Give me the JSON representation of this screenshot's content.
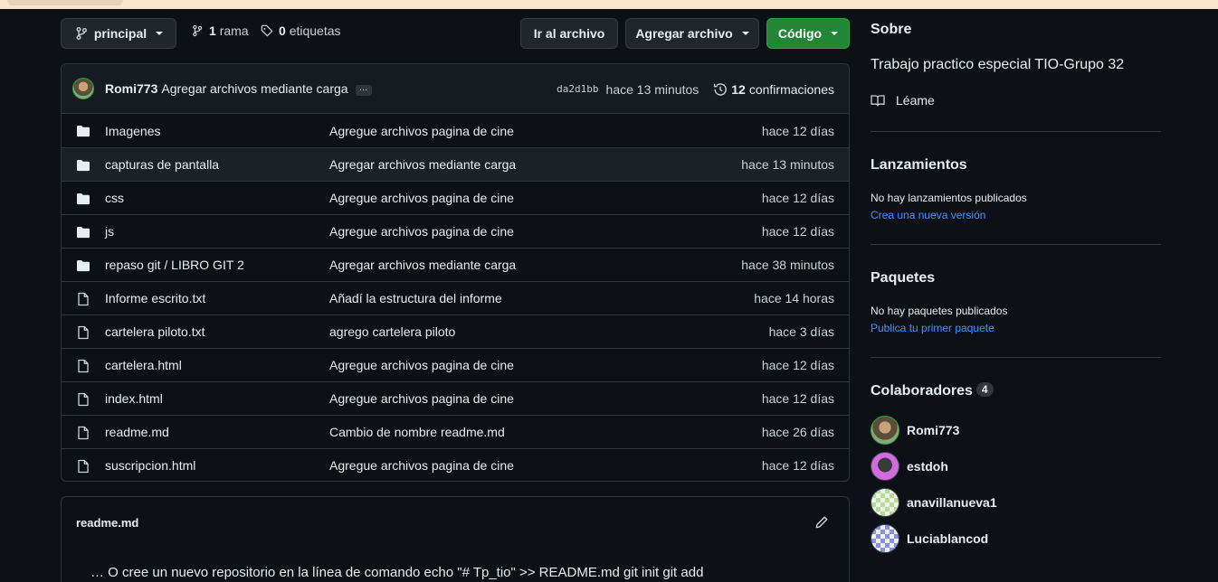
{
  "toolbar": {
    "branch_label": "principal",
    "branches_count": "1",
    "branches_word": "rama",
    "tags_count": "0",
    "tags_word": "etiquetas",
    "go_to_file": "Ir al archivo",
    "add_file": "Agregar archivo",
    "code": "Código"
  },
  "commit": {
    "author": "Romi773",
    "message": "Agregar archivos mediante carga",
    "ellipsis": "…",
    "sha": "da2d1bb",
    "time": "hace 13 minutos",
    "count": "12",
    "count_word": "confirmaciones"
  },
  "files": [
    {
      "type": "folder",
      "name": "Imagenes",
      "message": "Agregue archivos pagina de cine",
      "age": "hace 12 días"
    },
    {
      "type": "folder",
      "name": "capturas de pantalla",
      "message": "Agregar archivos mediante carga",
      "age": "hace 13 minutos"
    },
    {
      "type": "folder",
      "name": "css",
      "message": "Agregue archivos pagina de cine",
      "age": "hace 12 días"
    },
    {
      "type": "folder",
      "name": "js",
      "message": "Agregue archivos pagina de cine",
      "age": "hace 12 días"
    },
    {
      "type": "folder",
      "name": "repaso git / LIBRO GIT 2",
      "message": "Agregar archivos mediante carga",
      "age": "hace 38 minutos"
    },
    {
      "type": "file",
      "name": "Informe escrito.txt",
      "message": "Añadí la estructura del informe",
      "age": "hace 14 horas"
    },
    {
      "type": "file",
      "name": "cartelera piloto.txt",
      "message": "agrego cartelera piloto",
      "age": "hace 3 días"
    },
    {
      "type": "file",
      "name": "cartelera.html",
      "message": "Agregue archivos pagina de cine",
      "age": "hace 12 días"
    },
    {
      "type": "file",
      "name": "index.html",
      "message": "Agregue archivos pagina de cine",
      "age": "hace 12 días"
    },
    {
      "type": "file",
      "name": "readme.md",
      "message": "Cambio de nombre readme.md",
      "age": "hace 26 días"
    },
    {
      "type": "file",
      "name": "suscripcion.html",
      "message": "Agregue archivos pagina de cine",
      "age": "hace 12 días"
    }
  ],
  "readme": {
    "title": "readme.md",
    "body": "… O cree un nuevo repositorio en la línea de comando echo \"# Tp_tio\" >> README.md git init git add"
  },
  "sidebar": {
    "about_title": "Sobre",
    "description": "Trabajo practico especial TIO-Grupo 32",
    "readme_link": "Léame",
    "releases_title": "Lanzamientos",
    "releases_none": "No hay lanzamientos publicados",
    "releases_link": "Crea una nueva versión",
    "packages_title": "Paquetes",
    "packages_none": "No hay paquetes publicados",
    "packages_link": "Publica tu primer paquete",
    "contributors_title": "Colaboradores",
    "contributors_count": "4",
    "contributors": [
      {
        "name": "Romi773"
      },
      {
        "name": "estdoh"
      },
      {
        "name": "anavillanueva1"
      },
      {
        "name": "Luciablancod"
      }
    ]
  },
  "colors": {
    "background": "#0d1117",
    "border": "#30363d",
    "green": "#238636",
    "link": "#4493f8"
  }
}
